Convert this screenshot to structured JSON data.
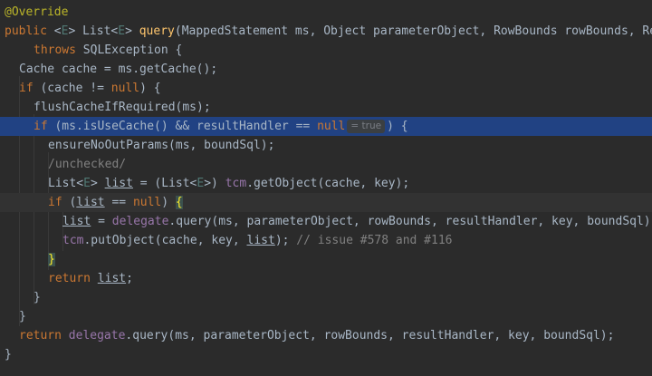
{
  "editor": {
    "language": "java",
    "theme_colors": {
      "background": "#2b2b2b",
      "default_text": "#a9b7c6",
      "keyword": "#cc7832",
      "annotation": "#bbb529",
      "method_declaration": "#ffc66d",
      "type_parameter": "#507874",
      "field": "#9876aa",
      "comment": "#808080",
      "selected_line": "#214283",
      "inlay_hint_bg": "#3b3f42"
    },
    "inlay_hint": "= true",
    "comment_text": "/unchecked/",
    "lines": {
      "l1": {
        "t1": "@Override"
      },
      "l2": {
        "t1": "public",
        "t2": " <",
        "t3": "E",
        "t4": "> List<",
        "t5": "E",
        "t6": "> ",
        "t7": "query",
        "t8": "(MappedStatement ms, Object parameterObject, RowBounds rowBounds, ResultHandler resultHandler, CacheKey key, BoundSql boundSql)"
      },
      "l3": {
        "t1": "throws",
        "t2": " SQLException {"
      },
      "l4": {
        "t1": "Cache cache = ms.getCache();"
      },
      "l5": {
        "t1": "if",
        "t2": " (cache != ",
        "t3": "null",
        "t4": ") {"
      },
      "l6": {
        "t1": "flushCacheIfRequired(ms);"
      },
      "l7": {
        "t1": "if",
        "t2": " (ms.isUseCache() && resultHandler == ",
        "t3": "null",
        "t4": ") {"
      },
      "l8": {
        "t1": "ensureNoOutParams(ms, boundSql);"
      },
      "l9": {
        "t1": "/unchecked/"
      },
      "l10": {
        "t1": "List<",
        "t2": "E",
        "t3": "> ",
        "t4": "list",
        "t5": " = (List<",
        "t6": "E",
        "t7": ">) ",
        "t8": "tcm",
        "t9": ".getObject(cache, key);"
      },
      "l11": {
        "t1": "if",
        "t2": " (",
        "t3": "list",
        "t4": " == ",
        "t5": "null",
        "t6": ") ",
        "t7": "{"
      },
      "l12": {
        "t1": "list",
        "t2": " = ",
        "t3": "delegate",
        "t4": ".query(ms, parameterObject, rowBounds, resultHandler, key, boundSql);"
      },
      "l13": {
        "t1": "tcm",
        "t2": ".putObject(cache, key, ",
        "t3": "list",
        "t4": "); ",
        "t5": "// issue #578 and #116"
      },
      "l14": {
        "t1": "}"
      },
      "l15": {
        "t1": "return",
        "t2": " ",
        "t3": "list",
        "t4": ";"
      },
      "l16": {
        "t1": "}"
      },
      "l17": {
        "t1": "}"
      },
      "l18": {
        "t1": "return",
        "t2": " ",
        "t3": "delegate",
        "t4": ".query(ms, parameterObject, rowBounds, resultHandler, key, boundSql);"
      },
      "l19": {
        "t1": "}"
      }
    }
  }
}
